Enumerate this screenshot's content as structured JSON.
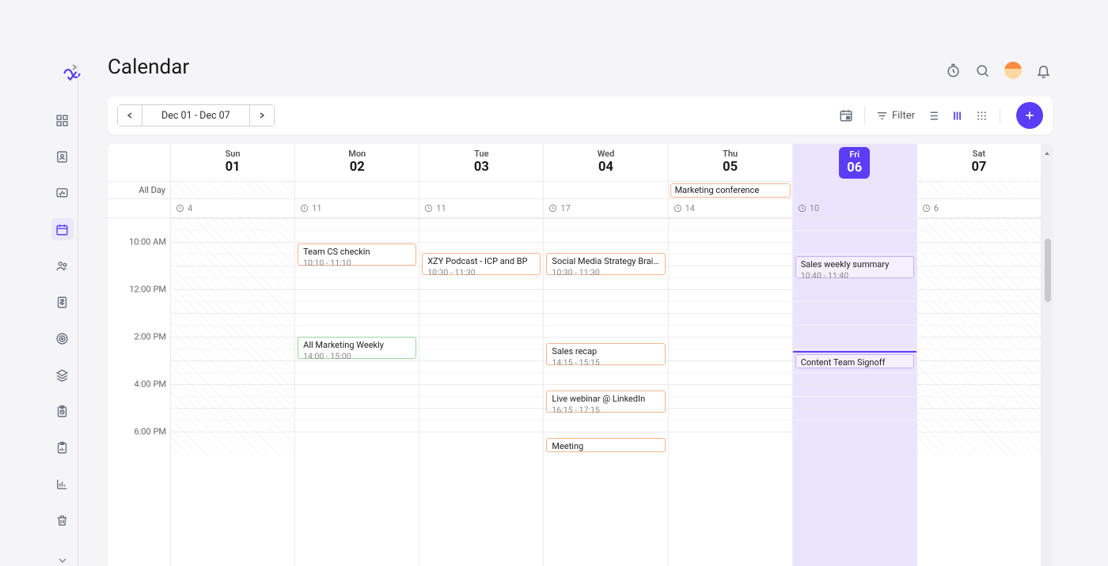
{
  "page_title": "Calendar",
  "date_range": "Dec 01 - Dec 07",
  "toolbar": {
    "filter_label": "Filter"
  },
  "days": [
    {
      "dow": "Sun",
      "num": "01",
      "count": "4"
    },
    {
      "dow": "Mon",
      "num": "02",
      "count": "11"
    },
    {
      "dow": "Tue",
      "num": "03",
      "count": "11"
    },
    {
      "dow": "Wed",
      "num": "04",
      "count": "17"
    },
    {
      "dow": "Thu",
      "num": "05",
      "count": "14"
    },
    {
      "dow": "Fri",
      "num": "06",
      "count": "10"
    },
    {
      "dow": "Sat",
      "num": "07",
      "count": "6"
    }
  ],
  "allday_label": "All Day",
  "time_labels": {
    "t10": "10:00 AM",
    "t12": "12:00 PM",
    "t14": "2:00 PM",
    "t16": "4:00 PM",
    "t18": "6:00 PM"
  },
  "allday_events": {
    "thu": "Marketing conference"
  },
  "events": {
    "mon_checkin_title": "Team CS checkin",
    "mon_checkin_time": "10:10 - 11:10",
    "mon_marketing_title": "All Marketing Weekly",
    "mon_marketing_time": "14:00 - 15:00",
    "tue_podcast_title": "XZY Podcast - ICP and BP",
    "tue_podcast_time": "10:30 - 11:30",
    "wed_social_title": "Social Media Strategy Brain...",
    "wed_social_time": "10:30 - 11:30",
    "wed_recap_title": "Sales recap",
    "wed_recap_time": "14:15 - 15:15",
    "wed_webinar_title": "Live webinar @ LinkedIn",
    "wed_webinar_time": "16:15 - 17:15",
    "wed_meeting_title": "Meeting",
    "fri_sales_title": "Sales weekly summary",
    "fri_sales_time": "10:40 - 11:40",
    "fri_content_title": "Content Team Signoff"
  }
}
